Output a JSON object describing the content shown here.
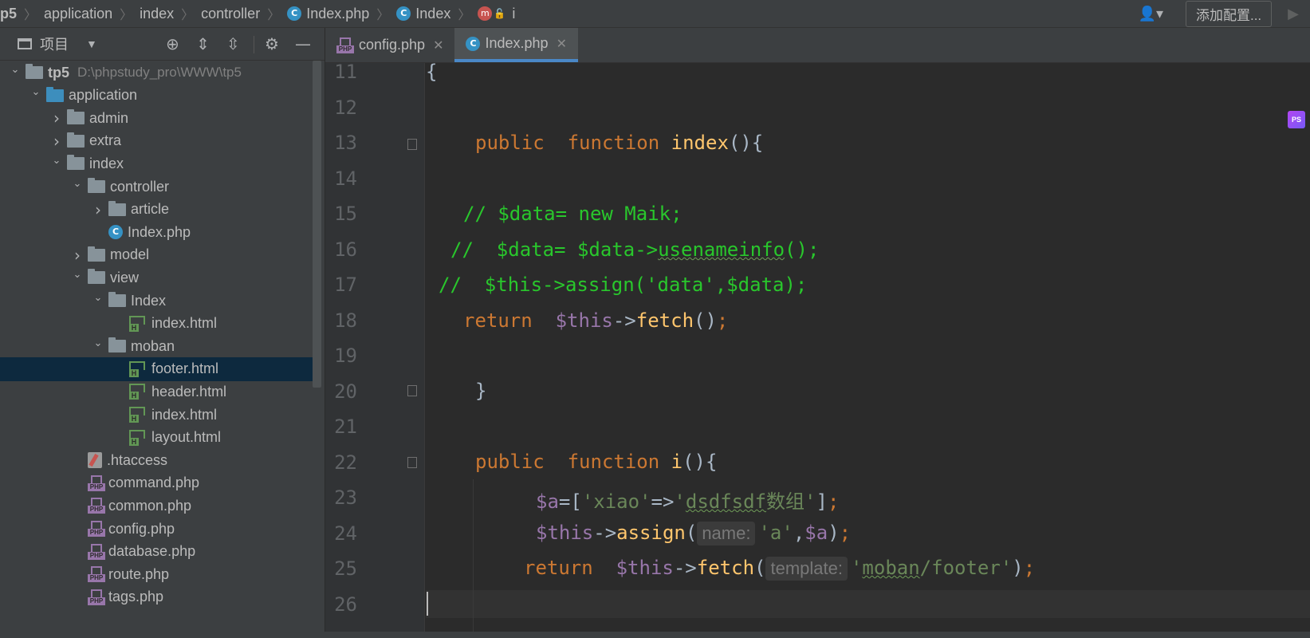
{
  "breadcrumb": {
    "root": "p5",
    "items": [
      "application",
      "index",
      "controller",
      "Index.php",
      "Index",
      "i"
    ]
  },
  "navright": {
    "user_icon": "user-icon",
    "add_config_label": "添加配置...",
    "run_icon": "run-icon"
  },
  "project_panel": {
    "title": "项目",
    "toolbar_icons": [
      "locate-icon",
      "expand-all-icon",
      "collapse-all-icon",
      "gear-icon",
      "minimize-icon"
    ]
  },
  "tree": [
    {
      "label": "tp5",
      "path": "D:\\phpstudy_pro\\WWW\\tp5",
      "depth": 0,
      "type": "folder",
      "expanded": true
    },
    {
      "label": "application",
      "depth": 1,
      "type": "folder-blue",
      "expanded": true
    },
    {
      "label": "admin",
      "depth": 2,
      "type": "folder",
      "expanded": false
    },
    {
      "label": "extra",
      "depth": 2,
      "type": "folder",
      "expanded": false
    },
    {
      "label": "index",
      "depth": 2,
      "type": "folder",
      "expanded": true
    },
    {
      "label": "controller",
      "depth": 3,
      "type": "folder",
      "expanded": true
    },
    {
      "label": "article",
      "depth": 4,
      "type": "folder",
      "expanded": false
    },
    {
      "label": "Index.php",
      "depth": 4,
      "type": "class"
    },
    {
      "label": "model",
      "depth": 3,
      "type": "folder",
      "expanded": false
    },
    {
      "label": "view",
      "depth": 3,
      "type": "folder",
      "expanded": true
    },
    {
      "label": "Index",
      "depth": 4,
      "type": "folder",
      "expanded": true
    },
    {
      "label": "index.html",
      "depth": 5,
      "type": "html"
    },
    {
      "label": "moban",
      "depth": 4,
      "type": "folder",
      "expanded": true
    },
    {
      "label": "footer.html",
      "depth": 5,
      "type": "html",
      "selected": true
    },
    {
      "label": "header.html",
      "depth": 5,
      "type": "html"
    },
    {
      "label": "index.html",
      "depth": 5,
      "type": "html"
    },
    {
      "label": "layout.html",
      "depth": 5,
      "type": "html"
    },
    {
      "label": ".htaccess",
      "depth": 3,
      "type": "htaccess"
    },
    {
      "label": "command.php",
      "depth": 3,
      "type": "php"
    },
    {
      "label": "common.php",
      "depth": 3,
      "type": "php"
    },
    {
      "label": "config.php",
      "depth": 3,
      "type": "php"
    },
    {
      "label": "database.php",
      "depth": 3,
      "type": "php"
    },
    {
      "label": "route.php",
      "depth": 3,
      "type": "php"
    },
    {
      "label": "tags.php",
      "depth": 3,
      "type": "php"
    }
  ],
  "tabs": [
    {
      "label": "config.php",
      "type": "php",
      "active": false
    },
    {
      "label": "Index.php",
      "type": "class",
      "active": true
    }
  ],
  "editor": {
    "line_numbers": [
      "11",
      "12",
      "13",
      "14",
      "15",
      "16",
      "17",
      "18",
      "19",
      "20",
      "21",
      "22",
      "23",
      "24",
      "25",
      "26"
    ],
    "hints": {
      "name": "name:",
      "template": "template:"
    }
  },
  "colors": {
    "keyword": "#cc7832",
    "function": "#ffc66d",
    "variable": "#9876aa",
    "string": "#6a8759",
    "comment": "#29c72c",
    "selection": "#0d293e"
  }
}
